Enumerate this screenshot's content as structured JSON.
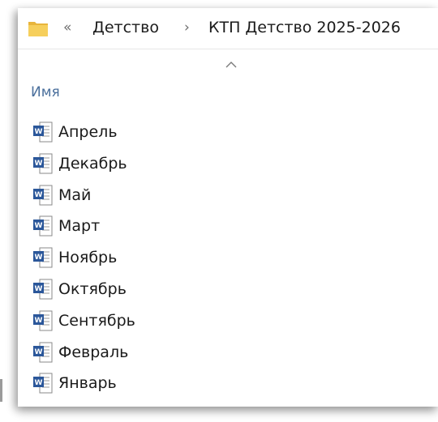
{
  "addressbar": {
    "back_chevrons": "«",
    "breadcrumb": [
      {
        "label": "Детство"
      },
      {
        "label": "КТП Детство 2025-2026"
      }
    ],
    "separator": "›"
  },
  "columns": {
    "name_header": "Имя",
    "sort_indicator": "ascending"
  },
  "files": [
    {
      "name": "Апрель",
      "icon": "word-document-icon"
    },
    {
      "name": "Декабрь",
      "icon": "word-document-icon"
    },
    {
      "name": "Май",
      "icon": "word-document-icon"
    },
    {
      "name": "Март",
      "icon": "word-document-icon"
    },
    {
      "name": "Ноябрь",
      "icon": "word-document-icon"
    },
    {
      "name": "Октябрь",
      "icon": "word-document-icon"
    },
    {
      "name": "Сентябрь",
      "icon": "word-document-icon"
    },
    {
      "name": "Февраль",
      "icon": "word-document-icon"
    },
    {
      "name": "Январь",
      "icon": "word-document-icon"
    }
  ],
  "colors": {
    "header_text": "#4a6f9c",
    "word_blue": "#2b579a",
    "folder_yellow": "#f3c54a"
  }
}
